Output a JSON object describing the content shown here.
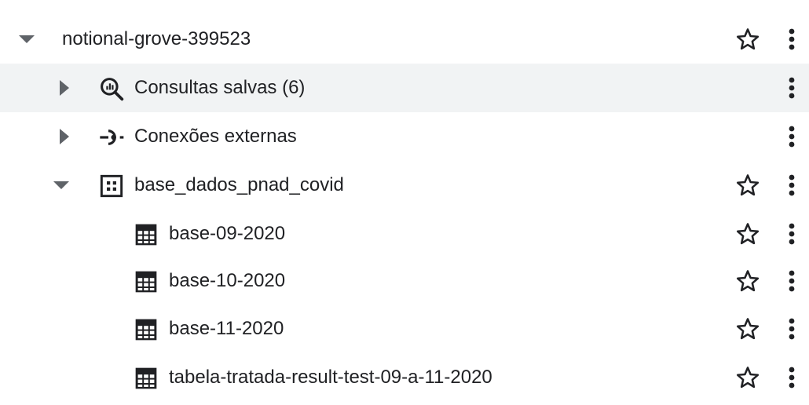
{
  "explorer": {
    "project": {
      "label": "notional-grove-399523",
      "icons": {
        "toggle": "caret-down-icon",
        "star": "star-outline-icon",
        "more": "more-vert-icon"
      }
    },
    "saved_queries": {
      "label": "Consultas salvas (6)",
      "icons": {
        "toggle": "caret-right-icon",
        "type": "saved-query-icon",
        "more": "more-vert-icon"
      }
    },
    "external_connections": {
      "label": "Conexões externas",
      "icons": {
        "toggle": "caret-right-icon",
        "type": "external-connection-icon",
        "more": "more-vert-icon"
      }
    },
    "dataset": {
      "label": "base_dados_pnad_covid",
      "icons": {
        "toggle": "caret-down-icon",
        "type": "dataset-icon",
        "star": "star-outline-icon",
        "more": "more-vert-icon"
      }
    },
    "tables": [
      {
        "label": "base-09-2020"
      },
      {
        "label": "base-10-2020"
      },
      {
        "label": "base-11-2020"
      },
      {
        "label": "tabela-tratada-result-test-09-a-11-2020"
      }
    ],
    "table_icons": {
      "type": "table-icon",
      "star": "star-outline-icon",
      "more": "more-vert-icon"
    },
    "colors": {
      "text": "#202124",
      "icon": "#202124",
      "caret": "#5f6368",
      "highlight_row": "#f1f3f4",
      "background": "#ffffff"
    }
  }
}
